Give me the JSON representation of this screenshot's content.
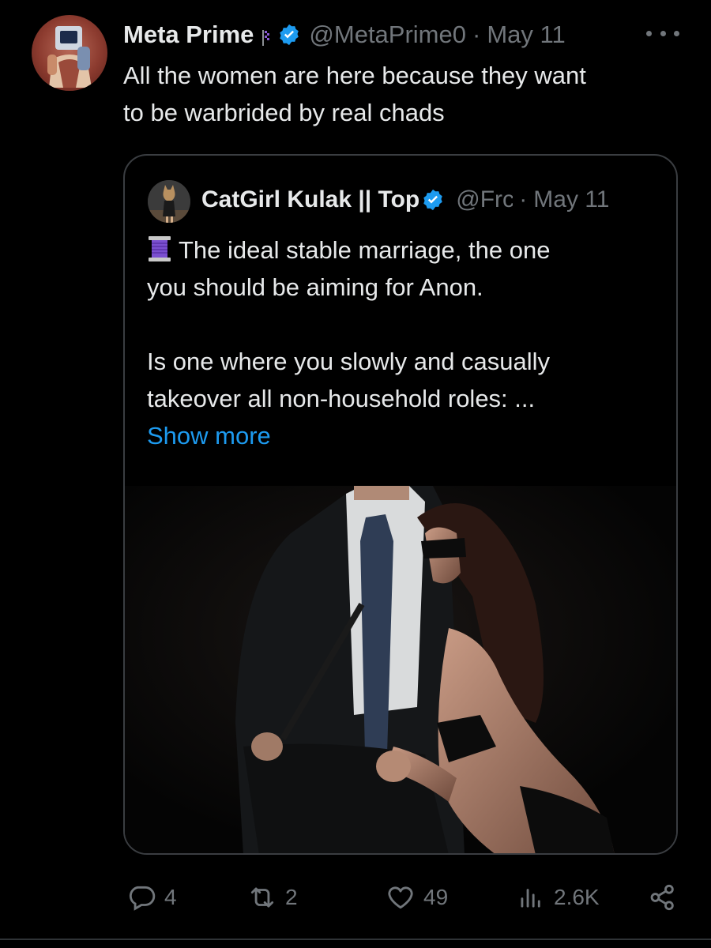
{
  "tweet": {
    "author": {
      "display_name": "Meta Prime",
      "handle": "@MetaPrime0",
      "verified": true,
      "avatar_icon": "robot-avatar-icon"
    },
    "date": "May 11",
    "separator": "·",
    "text": "All the women are here because they want\nto be warbrided by real chads",
    "more_icon": "ellipsis-icon"
  },
  "quote": {
    "author": {
      "display_name": "CatGirl Kulak || Top",
      "handle": "@Frc",
      "verified": true,
      "avatar_icon": "catgirl-avatar-icon"
    },
    "date": "May 11",
    "separator": "·",
    "text_line1": "The ideal stable marriage, the one",
    "text_line2": "you should be aiming for Anon.",
    "text_line3": "Is one where you slowly and casually",
    "text_line4": "takeover all non-household roles: ...",
    "show_more": "Show more",
    "lead_emoji": "thread-spool-icon",
    "media_icon": "photo-couple-icon"
  },
  "actions": {
    "reply_count": "4",
    "retweet_count": "2",
    "like_count": "49",
    "views_count": "2.6K"
  },
  "colors": {
    "background": "#000000",
    "text": "#e7e9ea",
    "muted": "#71767b",
    "link": "#1d9bf0",
    "verified": "#1d9bf0",
    "border": "#3a3d41"
  }
}
